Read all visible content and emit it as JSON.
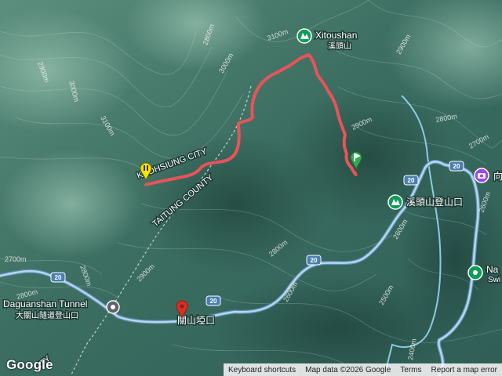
{
  "labels": {
    "xitoushan": "Xitoushan",
    "xitoushan_zh": "溪頭山",
    "trailhead_zh": "溪頭山登山口",
    "kaohsiung": "KAOHSIUNG CITY",
    "taitung": "TAITUNG COUNTY",
    "tunnel": "Daguanshan Tunnel",
    "tunnel_zh": "大關山隧道登山口",
    "yakou_zh": "關山埡口",
    "right_na": "Na",
    "right_swi": "Swi",
    "right_purple": "向",
    "bottom_ity": "ITY"
  },
  "contours": [
    "2900m",
    "3100m",
    "2800m",
    "3000m",
    "3100m",
    "3000m",
    "2900m",
    "2800m",
    "2800m",
    "2700m",
    "2900m",
    "2600m",
    "2800m",
    "2700m",
    "2900m",
    "2500m",
    "2600m",
    "2800m",
    "2600m",
    "2400m"
  ],
  "road_number": "20",
  "attribution": {
    "shortcuts": "Keyboard shortcuts",
    "mapdata": "Map data ©2026 Google",
    "terms": "Terms",
    "report": "Report a map error"
  },
  "logo": "Google",
  "colors": {
    "track": "#e8535a",
    "road": "#7fb2d6",
    "poi_green": "#0f9d58",
    "marker_red": "#d93025",
    "marker_yellow": "#f7e600",
    "marker_green": "#34a853",
    "purple": "#a142f4"
  }
}
